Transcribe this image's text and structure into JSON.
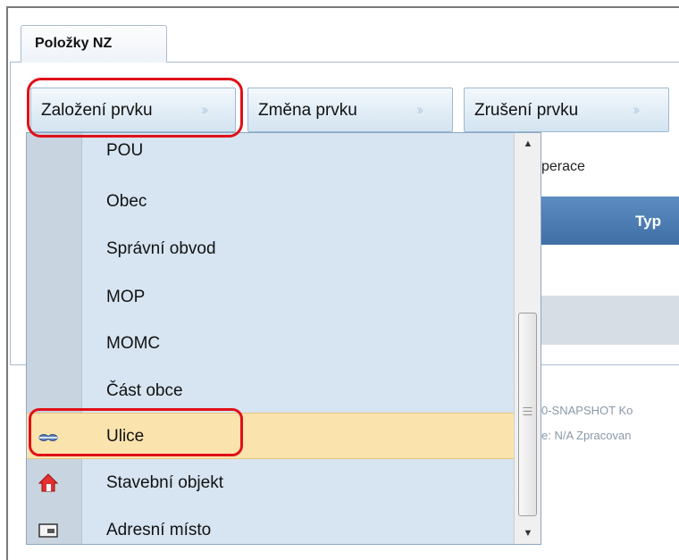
{
  "tabs": {
    "active_label": "Položky NZ"
  },
  "toolbar": {
    "create_label": "Založení prvku",
    "change_label": "Změna prvku",
    "delete_label": "Zrušení prvku",
    "chevron": "»"
  },
  "background": {
    "operation_label": "perace",
    "grid_header": "Typ",
    "footer_line1": "0-SNAPSHOT Ko",
    "footer_line2": "e: N/A Zpracovan"
  },
  "dropdown": {
    "items": [
      {
        "label": "POU",
        "icon": ""
      },
      {
        "label": "Obec",
        "icon": ""
      },
      {
        "label": "Správní obvod",
        "icon": ""
      },
      {
        "label": "MOP",
        "icon": ""
      },
      {
        "label": "MOMC",
        "icon": ""
      },
      {
        "label": "Část obce",
        "icon": ""
      },
      {
        "label": "Ulice",
        "icon": "street-icon",
        "selected": true
      },
      {
        "label": "Stavební objekt",
        "icon": "house-icon"
      },
      {
        "label": "Adresní místo",
        "icon": "address-plate-icon"
      }
    ]
  },
  "colors": {
    "highlight_ring": "#e01018",
    "selected_item": "#fbe3ad",
    "menu_bg": "#d7e4f1",
    "grid_header_bg": "#4a7bb1"
  }
}
